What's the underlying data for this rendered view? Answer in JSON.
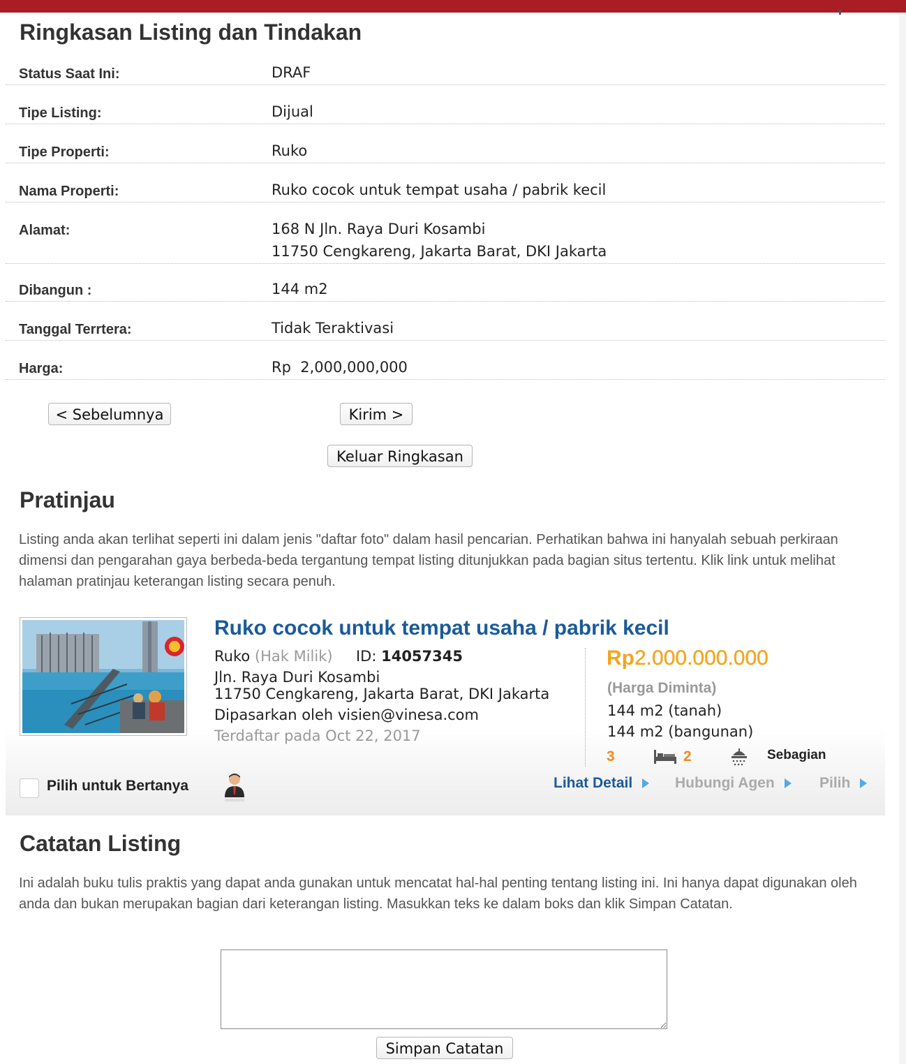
{
  "summary": {
    "title": "Ringkasan Listing dan Tindakan",
    "rows": [
      {
        "label": "Status Saat Ini:",
        "value": "DRAF"
      },
      {
        "label": "Tipe Listing:",
        "value": "Dijual"
      },
      {
        "label": "Tipe Properti:",
        "value": "Ruko"
      },
      {
        "label": "Nama Properti:",
        "value": "Ruko cocok untuk tempat usaha / pabrik kecil"
      },
      {
        "label": "Alamat:",
        "value": "168 N Jln. Raya Duri Kosambi",
        "value2": "11750 Cengkareng, Jakarta Barat, DKI Jakarta"
      },
      {
        "label": "Dibangun :",
        "value": "144 m2"
      },
      {
        "label": "Tanggal Terrtera:",
        "value": "Tidak Teraktivasi"
      },
      {
        "label": "Harga:",
        "value": "Rp  2,000,000,000"
      }
    ],
    "prev_button": "< Sebelumnya",
    "submit_button": "Kirim >",
    "exit_button": "Keluar Ringkasan"
  },
  "preview": {
    "title": "Pratinjau",
    "description": "Listing anda akan terlihat seperti ini dalam jenis \"daftar foto\" dalam hasil pencarian. Perhatikan bahwa ini hanyalah sebuah perkiraan dimensi dan pengarahan gaya berbeda-beda tergantung tempat listing ditunjukkan pada bagian situs tertentu. Klik link untuk melihat halaman pratinjau keterangan listing secara penuh.",
    "card": {
      "title": "Ruko cocok untuk tempat usaha / pabrik kecil",
      "type": "Ruko",
      "ownership": "(Hak Milik)",
      "id_label": "ID:",
      "id_value": "14057345",
      "street": "Jln. Raya Duri Kosambi",
      "city": "11750 Cengkareng, Jakarta Barat, DKI Jakarta",
      "marketed_by": "Dipasarkan oleh visien@vinesa.com",
      "listed_on": "Terdaftar pada Oct 22, 2017",
      "price_currency": "Rp",
      "price_amount": "2.000.000.000",
      "price_note": "(Harga Diminta)",
      "land_area": "144 m2 (tanah)",
      "building_area": "144 m2 (bangunan)",
      "bedrooms": "3",
      "bathrooms": "2",
      "furnishing": "Sebagian",
      "select_label": "Pilih untuk Bertanya",
      "detail_link": "Lihat Detail",
      "contact_link": "Hubungi Agen",
      "choose_link": "Pilih",
      "accent_color": "#1a5a9a",
      "price_color": "#f3a51d"
    }
  },
  "notes": {
    "title": "Catatan Listing",
    "description": "Ini adalah buku tulis praktis yang dapat anda gunakan untuk mencatat hal-hal penting tentang listing ini. Ini hanya dapat digunakan oleh anda dan bukan merupakan bagian dari keterangan listing. Masukkan teks ke dalam boks dan klik Simpan Catatan.",
    "textarea_value": "",
    "save_button": "Simpan Catatan"
  },
  "theme": {
    "topbar_color": "#a81e24"
  }
}
